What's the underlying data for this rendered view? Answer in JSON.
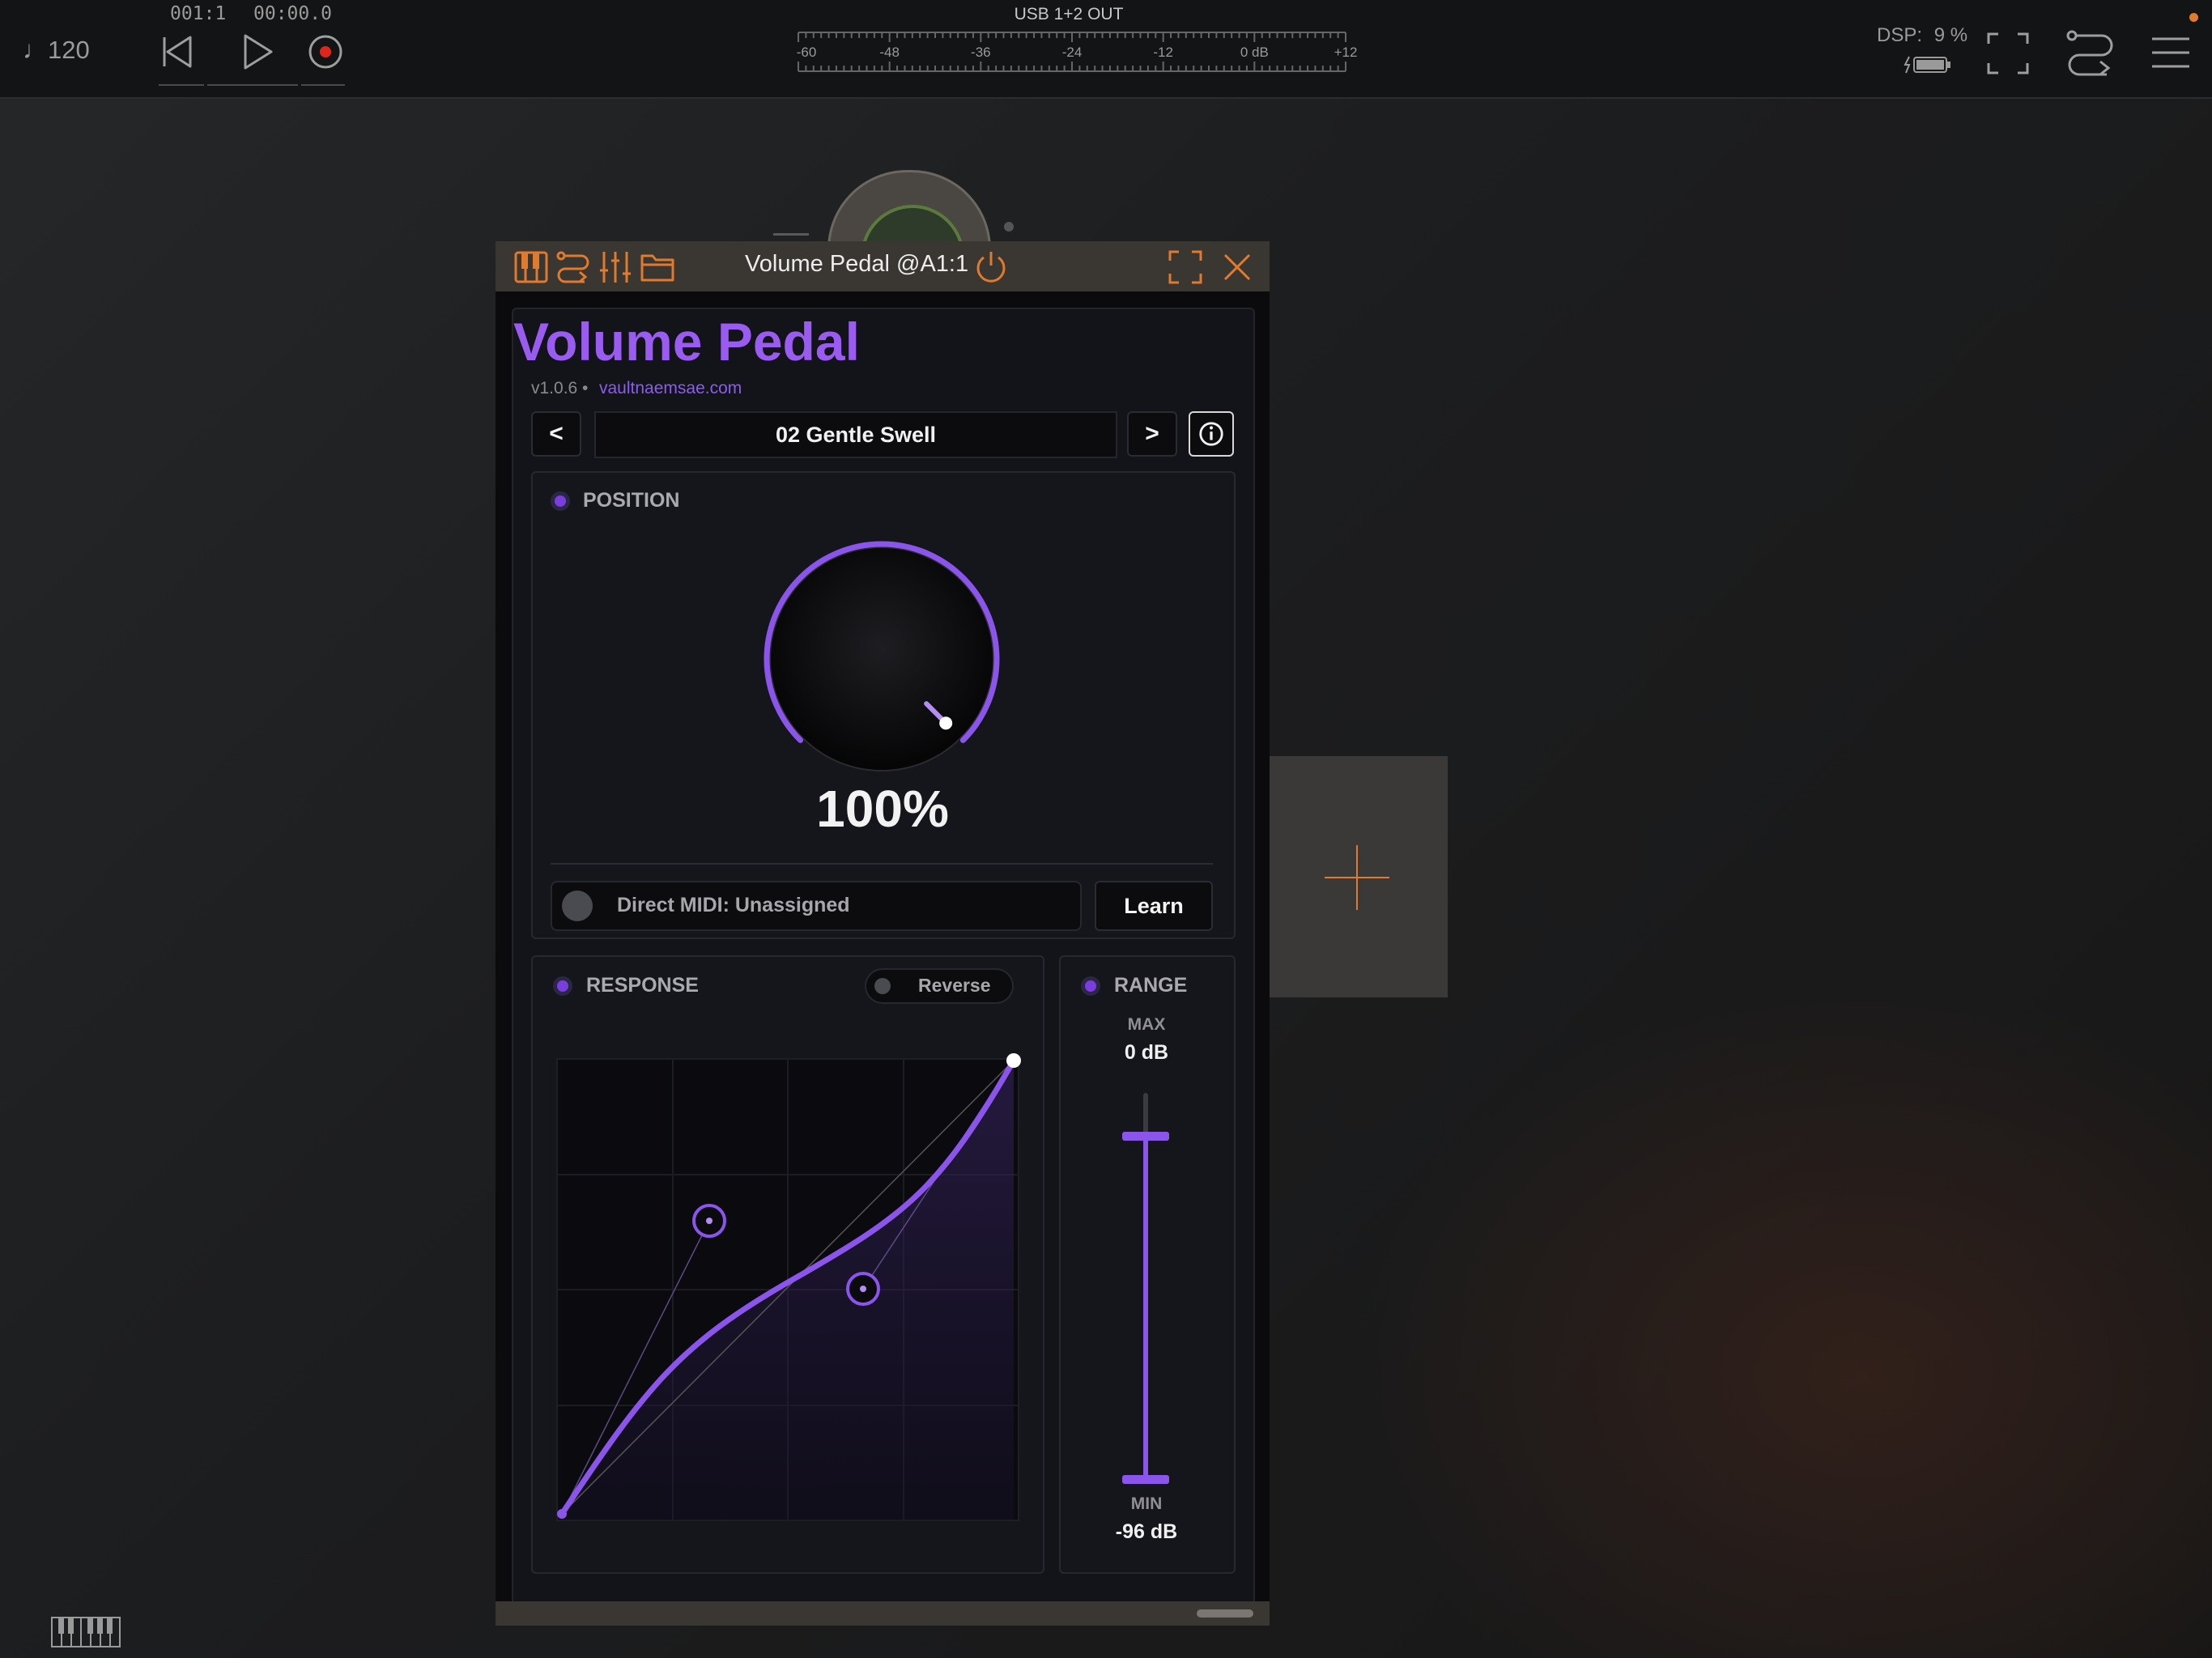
{
  "transport": {
    "tempo": "♩120",
    "bar_position": "001:1",
    "time_position": "00:00.0"
  },
  "meter": {
    "output_label": "USB 1+2 OUT",
    "scale": [
      "-60",
      "-48",
      "-36",
      "-24",
      "-12",
      "0 dB",
      "+12"
    ],
    "peak_left": "-∞",
    "peak_right": "-∞"
  },
  "status": {
    "dsp_label": "DSP:",
    "dsp_value": "9 %"
  },
  "plugin_window": {
    "title": "Volume Pedal @A1:1",
    "accent_color": "#e07a2e"
  },
  "plugin": {
    "name": "Volume Pedal",
    "version": "v1.0.6 •",
    "website": "vaultnaemsae.com",
    "preset": {
      "prev_label": "<",
      "next_label": ">",
      "current": "02  Gentle Swell"
    },
    "position": {
      "title": "POSITION",
      "value": "100%",
      "value_fraction": 1.0
    },
    "midi": {
      "status": "Direct MIDI: Unassigned",
      "learn_label": "Learn"
    },
    "response": {
      "title": "RESPONSE",
      "reverse_label": "Reverse"
    },
    "range": {
      "title": "RANGE",
      "max_label": "MAX",
      "max_value": "0 dB",
      "min_label": "MIN",
      "min_value": "-96 dB"
    },
    "accent_color": "#8b55ec"
  },
  "icons": {
    "transport": [
      "rewind-icon",
      "play-icon",
      "record-icon"
    ],
    "toolbar": [
      "piano-icon",
      "routing-icon",
      "mixer-icon",
      "folder-icon",
      "power-icon",
      "fullscreen-icon",
      "close-icon"
    ],
    "top_right": [
      "battery-icon",
      "fullscreen-icon",
      "routing-icon",
      "menu-icon"
    ]
  }
}
